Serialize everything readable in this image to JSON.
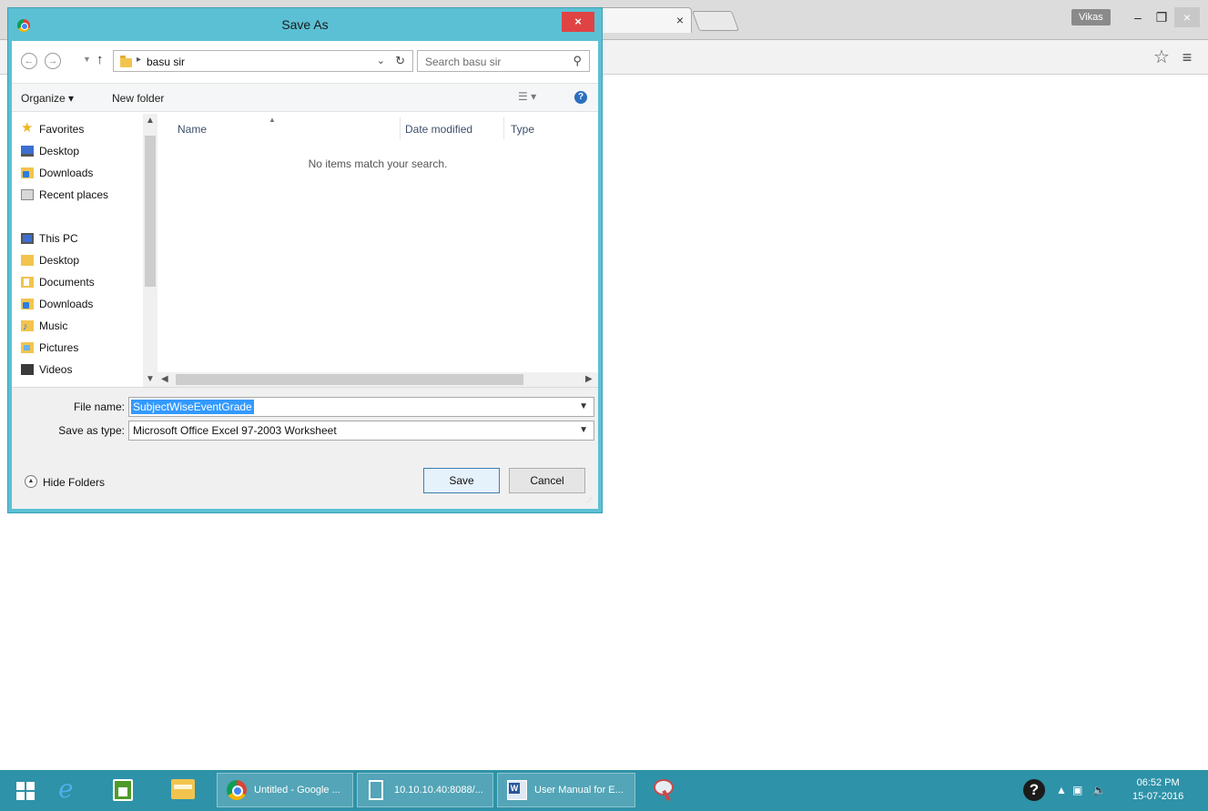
{
  "browser": {
    "tab_close": "×",
    "user_name": "Vikas",
    "minimize_label": "‒",
    "restore_label": "❐",
    "close_label": "×",
    "bookmark_icon": "star-outline-icon",
    "menu_icon": "hamburger-menu-icon"
  },
  "dialog": {
    "title": "Save As",
    "close_label": "×",
    "address": {
      "path": "basu sir"
    },
    "search": {
      "placeholder": "Search basu sir"
    },
    "command_bar": {
      "organize": "Organize ▾",
      "new_folder": "New folder"
    },
    "nav_pane": {
      "items": [
        {
          "label": "Favorites",
          "icon": "star-icon"
        },
        {
          "label": "Desktop",
          "icon": "desktop-icon"
        },
        {
          "label": "Downloads",
          "icon": "downloads-folder-icon"
        },
        {
          "label": "Recent places",
          "icon": "recent-places-icon"
        },
        {
          "label": "This PC",
          "icon": "computer-icon"
        },
        {
          "label": "Desktop",
          "icon": "folder-icon"
        },
        {
          "label": "Documents",
          "icon": "documents-folder-icon"
        },
        {
          "label": "Downloads",
          "icon": "downloads-folder-icon"
        },
        {
          "label": "Music",
          "icon": "music-folder-icon"
        },
        {
          "label": "Pictures",
          "icon": "pictures-folder-icon"
        },
        {
          "label": "Videos",
          "icon": "videos-folder-icon"
        }
      ]
    },
    "file_list": {
      "columns": [
        "Name",
        "Date modified",
        "Type"
      ],
      "empty_message": "No items match your search."
    },
    "file_name": {
      "label": "File name:",
      "value": "SubjectWiseEventGrade"
    },
    "save_as_type": {
      "label": "Save as type:",
      "value": "Microsoft Office Excel 97-2003 Worksheet"
    },
    "hide_folders": "Hide Folders",
    "save_button": "Save",
    "cancel_button": "Cancel"
  },
  "taskbar": {
    "apps": [
      {
        "label": "Untitled - Google ...",
        "icon": "chrome-icon"
      },
      {
        "label": "10.10.10.40:8088/...",
        "icon": "page-icon"
      },
      {
        "label": "User Manual for E...",
        "icon": "word-document-icon"
      }
    ],
    "clock": {
      "time": "06:52 PM",
      "date": "15-07-2016"
    }
  },
  "colors": {
    "dialog_frame": "#5bc0d4",
    "taskbar": "#2e92a8",
    "dialog_close": "#e04343",
    "selection": "#3399ff"
  }
}
